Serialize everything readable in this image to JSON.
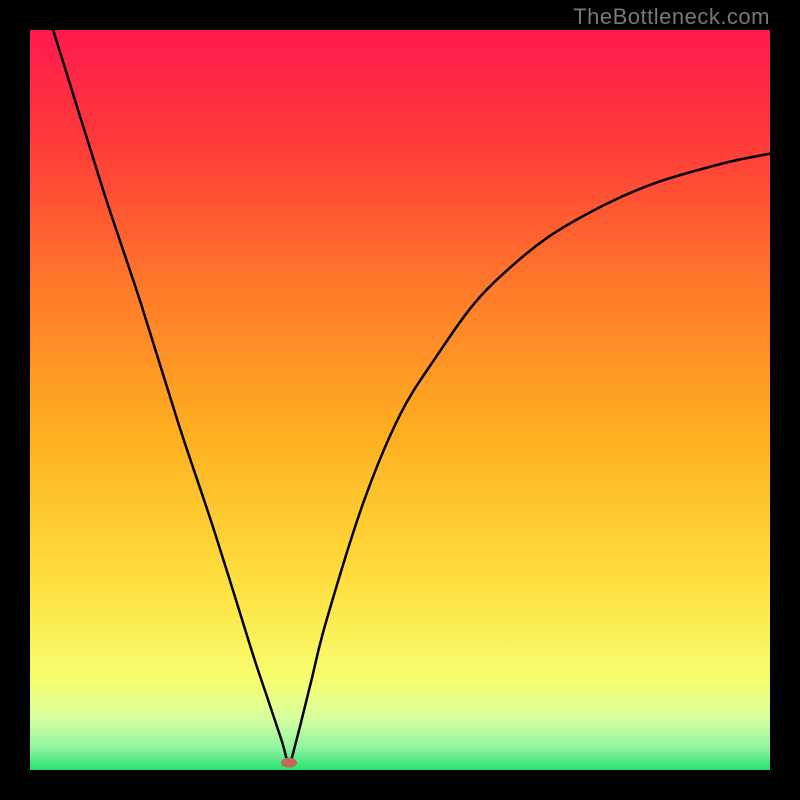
{
  "watermark": "TheBottleneck.com",
  "chart_data": {
    "type": "line",
    "title": "",
    "xlabel": "",
    "ylabel": "",
    "xlim": [
      0,
      100
    ],
    "ylim": [
      0,
      100
    ],
    "grid": false,
    "legend": false,
    "background_gradient": {
      "stops": [
        {
          "offset": 0.0,
          "color": "#ff1a4d"
        },
        {
          "offset": 0.15,
          "color": "#ff3a3a"
        },
        {
          "offset": 0.35,
          "color": "#ff7a2a"
        },
        {
          "offset": 0.55,
          "color": "#ffb020"
        },
        {
          "offset": 0.75,
          "color": "#ffe040"
        },
        {
          "offset": 0.88,
          "color": "#f6ff70"
        },
        {
          "offset": 0.93,
          "color": "#d8ffa0"
        },
        {
          "offset": 0.97,
          "color": "#90f5a0"
        },
        {
          "offset": 1.0,
          "color": "#28e070"
        }
      ]
    },
    "series": [
      {
        "name": "bottleneck-curve",
        "stroke": "#000000",
        "stroke_width": 2.5,
        "x": [
          0,
          5,
          10,
          15,
          20,
          25,
          30,
          32,
          34,
          35,
          36,
          38,
          40,
          45,
          50,
          55,
          60,
          65,
          70,
          75,
          80,
          85,
          90,
          95,
          100
        ],
        "y": [
          110,
          94,
          78,
          63,
          47,
          32,
          16,
          10,
          4,
          1,
          4,
          12,
          20,
          36,
          48,
          56,
          63,
          68,
          72,
          75,
          77.5,
          79.5,
          81,
          82.3,
          83.3
        ]
      }
    ],
    "marker": {
      "name": "optimal-point",
      "x": 35,
      "y": 1,
      "color": "#c16a5a",
      "rx": 8,
      "ry": 5
    }
  }
}
